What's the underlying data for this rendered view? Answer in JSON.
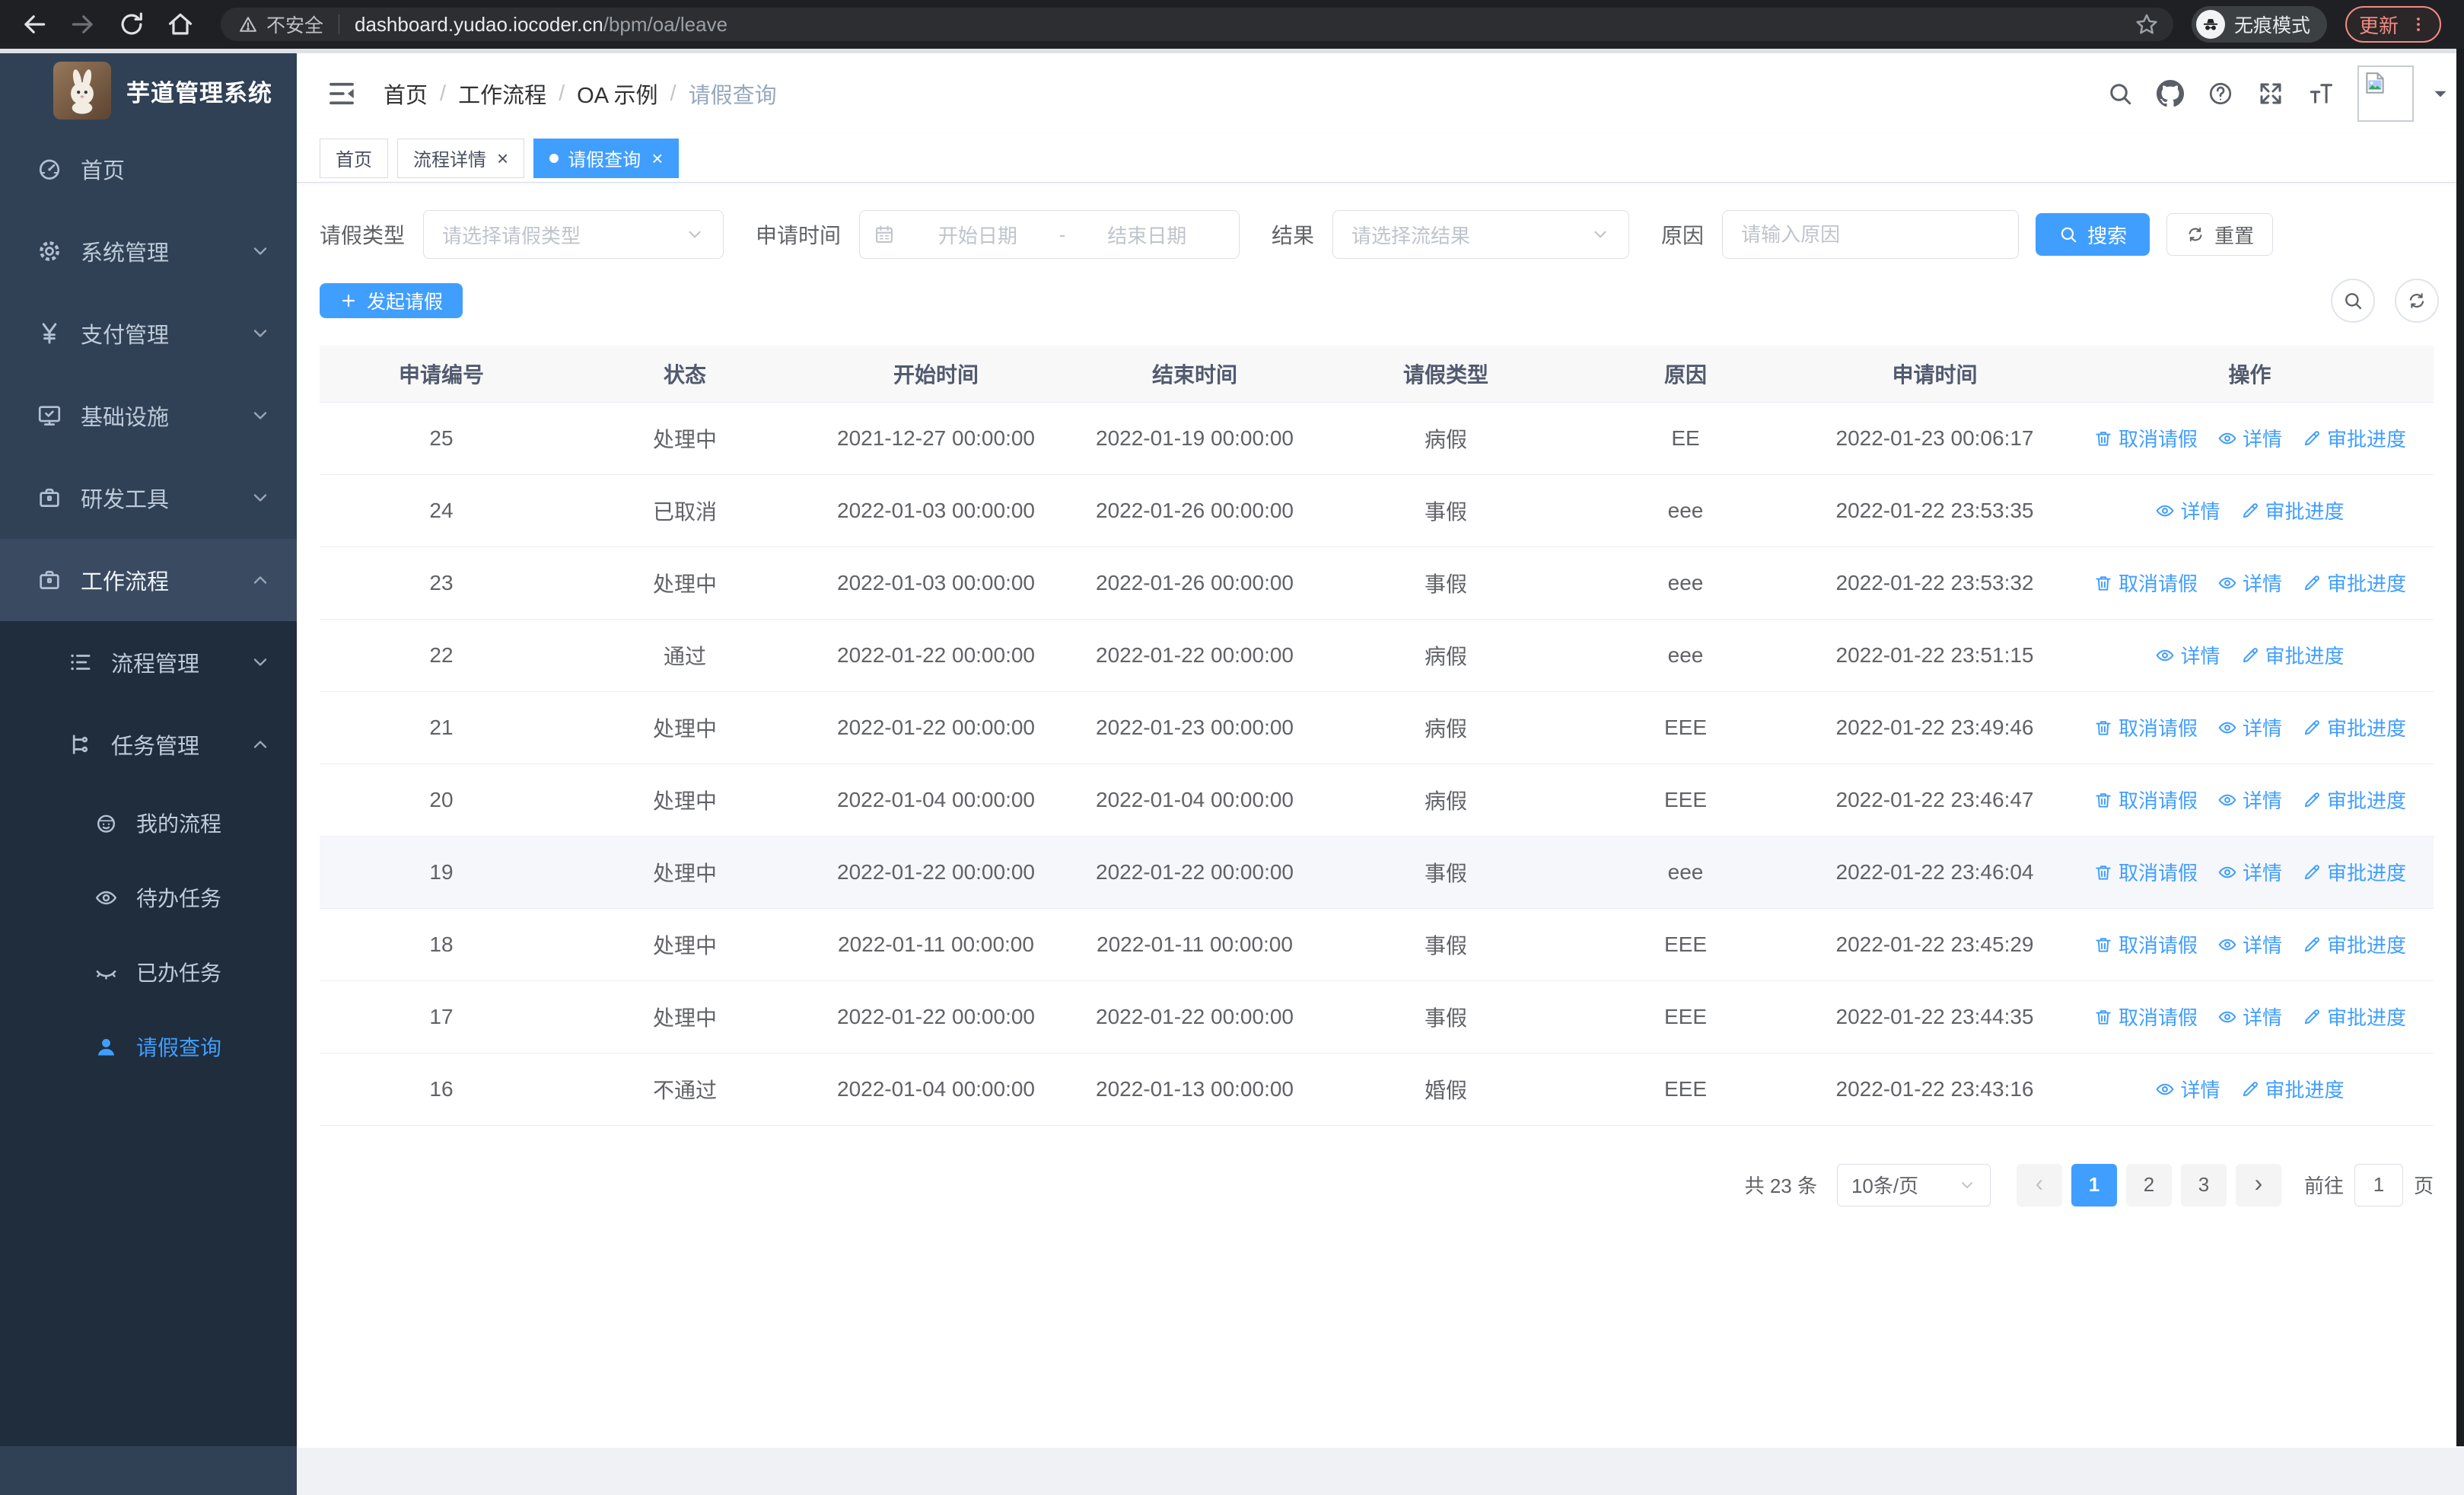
{
  "browser": {
    "security_label": "不安全",
    "url_host": "dashboard.yudao.iocoder.cn",
    "url_path": "/bpm/oa/leave",
    "incognito_label": "无痕模式",
    "update_label": "更新"
  },
  "sidebar": {
    "title": "芋道管理系统",
    "items": [
      {
        "label": "首页",
        "icon": "dashboard-icon"
      },
      {
        "label": "系统管理",
        "icon": "gear-icon"
      },
      {
        "label": "支付管理",
        "icon": "yen-icon"
      },
      {
        "label": "基础设施",
        "icon": "monitor-icon"
      },
      {
        "label": "研发工具",
        "icon": "briefcase-icon"
      },
      {
        "label": "工作流程",
        "icon": "briefcase-icon"
      }
    ],
    "submenu": [
      {
        "label": "流程管理",
        "icon": "list-icon"
      },
      {
        "label": "任务管理",
        "icon": "flow-icon"
      }
    ],
    "tasks": [
      {
        "label": "我的流程",
        "icon": "robot-icon"
      },
      {
        "label": "待办任务",
        "icon": "eye-icon"
      },
      {
        "label": "已办任务",
        "icon": "eye-closed-icon"
      },
      {
        "label": "请假查询",
        "icon": "user-icon"
      }
    ]
  },
  "header": {
    "breadcrumb": [
      "首页",
      "工作流程",
      "OA 示例",
      "请假查询"
    ]
  },
  "tabs": [
    {
      "label": "首页"
    },
    {
      "label": "流程详情"
    },
    {
      "label": "请假查询"
    }
  ],
  "filters": {
    "type_label": "请假类型",
    "type_placeholder": "请选择请假类型",
    "time_label": "申请时间",
    "start_placeholder": "开始日期",
    "range_separator": "-",
    "end_placeholder": "结束日期",
    "result_label": "结果",
    "result_placeholder": "请选择流结果",
    "reason_label": "原因",
    "reason_placeholder": "请输入原因",
    "search_label": "搜索",
    "reset_label": "重置"
  },
  "toolbar": {
    "create_label": "发起请假"
  },
  "table": {
    "headers": [
      "申请编号",
      "状态",
      "开始时间",
      "结束时间",
      "请假类型",
      "原因",
      "申请时间",
      "操作"
    ],
    "action_labels": {
      "cancel": "取消请假",
      "detail": "详情",
      "progress": "审批进度"
    },
    "action_icons": {
      "cancel": "delete-icon",
      "detail": "eye-icon",
      "progress": "edit-icon"
    },
    "rows": [
      {
        "id": "25",
        "status": "处理中",
        "start": "2021-12-27 00:00:00",
        "end": "2022-01-19 00:00:00",
        "type": "病假",
        "reason": "EE",
        "apply_time": "2022-01-23 00:06:17",
        "actions": [
          "cancel",
          "detail",
          "progress"
        ],
        "highlight": false
      },
      {
        "id": "24",
        "status": "已取消",
        "start": "2022-01-03 00:00:00",
        "end": "2022-01-26 00:00:00",
        "type": "事假",
        "reason": "eee",
        "apply_time": "2022-01-22 23:53:35",
        "actions": [
          "detail",
          "progress"
        ],
        "highlight": false
      },
      {
        "id": "23",
        "status": "处理中",
        "start": "2022-01-03 00:00:00",
        "end": "2022-01-26 00:00:00",
        "type": "事假",
        "reason": "eee",
        "apply_time": "2022-01-22 23:53:32",
        "actions": [
          "cancel",
          "detail",
          "progress"
        ],
        "highlight": false
      },
      {
        "id": "22",
        "status": "通过",
        "start": "2022-01-22 00:00:00",
        "end": "2022-01-22 00:00:00",
        "type": "病假",
        "reason": "eee",
        "apply_time": "2022-01-22 23:51:15",
        "actions": [
          "detail",
          "progress"
        ],
        "highlight": false
      },
      {
        "id": "21",
        "status": "处理中",
        "start": "2022-01-22 00:00:00",
        "end": "2022-01-23 00:00:00",
        "type": "病假",
        "reason": "EEE",
        "apply_time": "2022-01-22 23:49:46",
        "actions": [
          "cancel",
          "detail",
          "progress"
        ],
        "highlight": false
      },
      {
        "id": "20",
        "status": "处理中",
        "start": "2022-01-04 00:00:00",
        "end": "2022-01-04 00:00:00",
        "type": "病假",
        "reason": "EEE",
        "apply_time": "2022-01-22 23:46:47",
        "actions": [
          "cancel",
          "detail",
          "progress"
        ],
        "highlight": false
      },
      {
        "id": "19",
        "status": "处理中",
        "start": "2022-01-22 00:00:00",
        "end": "2022-01-22 00:00:00",
        "type": "事假",
        "reason": "eee",
        "apply_time": "2022-01-22 23:46:04",
        "actions": [
          "cancel",
          "detail",
          "progress"
        ],
        "highlight": true
      },
      {
        "id": "18",
        "status": "处理中",
        "start": "2022-01-11 00:00:00",
        "end": "2022-01-11 00:00:00",
        "type": "事假",
        "reason": "EEE",
        "apply_time": "2022-01-22 23:45:29",
        "actions": [
          "cancel",
          "detail",
          "progress"
        ],
        "highlight": false
      },
      {
        "id": "17",
        "status": "处理中",
        "start": "2022-01-22 00:00:00",
        "end": "2022-01-22 00:00:00",
        "type": "事假",
        "reason": "EEE",
        "apply_time": "2022-01-22 23:44:35",
        "actions": [
          "cancel",
          "detail",
          "progress"
        ],
        "highlight": false
      },
      {
        "id": "16",
        "status": "不通过",
        "start": "2022-01-04 00:00:00",
        "end": "2022-01-13 00:00:00",
        "type": "婚假",
        "reason": "EEE",
        "apply_time": "2022-01-22 23:43:16",
        "actions": [
          "detail",
          "progress"
        ],
        "highlight": false
      }
    ]
  },
  "pagination": {
    "total_label": "共 23 条",
    "page_size": "10条/页",
    "pages": [
      "1",
      "2",
      "3"
    ],
    "active_page": "1",
    "goto_label": "前往",
    "goto_value": "1",
    "page_unit": "页"
  }
}
